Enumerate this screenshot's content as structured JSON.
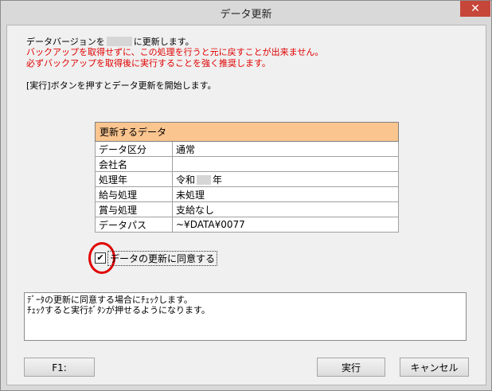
{
  "window": {
    "title": "データ更新",
    "close_glyph": "✕"
  },
  "messages": {
    "line1_before": "データバージョンを",
    "line1_after": "に更新します。",
    "warn1": "バックアップを取得せずに、この処理を行うと元に戻すことが出来ません。",
    "warn2": "必ずバックアップを取得後に実行することを強く推奨します。",
    "instruction": "[実行]ボタンを押すとデータ更新を開始します。"
  },
  "table": {
    "header": "更新するデータ",
    "rows": [
      {
        "key": "データ区分",
        "value": "通常"
      },
      {
        "key": "会社名",
        "value": ""
      },
      {
        "key": "処理年",
        "value_before": "令和",
        "value_after": "年"
      },
      {
        "key": "給与処理",
        "value": "未処理"
      },
      {
        "key": "賞与処理",
        "value": "支給なし"
      },
      {
        "key": "データパス",
        "value": "~¥DATA¥0077"
      }
    ]
  },
  "agree": {
    "checked": true,
    "check_glyph": "✔",
    "label": "データの更新に同意する"
  },
  "info": {
    "lines": [
      "ﾃﾞｰﾀの更新に同意する場合にﾁｪｯｸします。",
      "ﾁｪｯｸすると実行ﾎﾞﾀﾝが押せるようになります。"
    ]
  },
  "buttons": {
    "f1": "F1:",
    "execute": "実行",
    "cancel": "キャンセル"
  },
  "colors": {
    "table_header": "#fbc58f",
    "warning_text": "#e00000",
    "close_button": "#c7463a",
    "highlight_circle": "#e00000"
  }
}
